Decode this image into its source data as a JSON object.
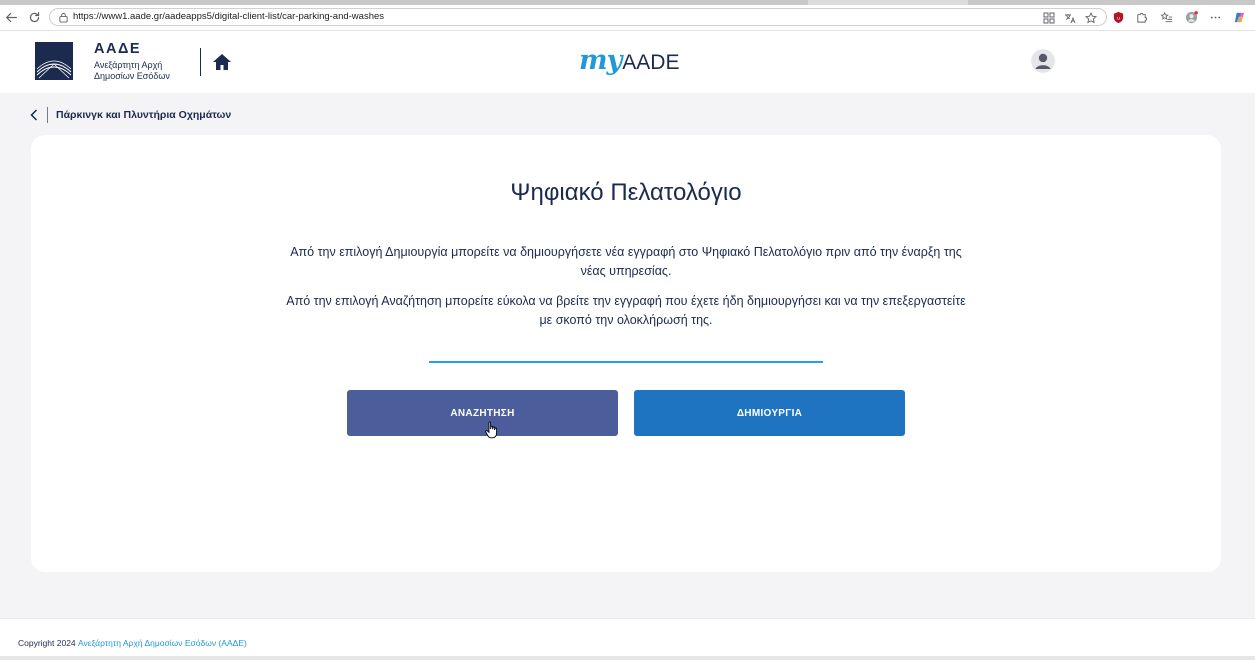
{
  "browser": {
    "url": "https://www1.aade.gr/aadeapps5/digital-client-list/car-parking-and-washes"
  },
  "header": {
    "logo_title": "ΑΑΔΕ",
    "logo_subtitle_line1": "Ανεξάρτητη Αρχή",
    "logo_subtitle_line2": "Δημοσίων Εσόδων",
    "brand_my": "my",
    "brand_aade": "AADE"
  },
  "breadcrumb": {
    "title": "Πάρκινγκ και Πλυντήρια Οχημάτων"
  },
  "main": {
    "title": "Ψηφιακό Πελατολόγιο",
    "description_1": "Από την επιλογή Δημιουργία μπορείτε να δημιουργήσετε νέα εγγραφή στο Ψηφιακό Πελατολόγιο πριν από την έναρξη της νέας υπηρεσίας.",
    "description_2": "Από την επιλογή Αναζήτηση μπορείτε εύκολα να βρείτε την εγγραφή που έχετε ήδη δημιουργήσει και να την επεξεργαστείτε με σκοπό την ολοκλήρωσή της.",
    "search_button": "ΑΝΑΖΗΤΗΣΗ",
    "create_button": "ΔΗΜΙΟΥΡΓΙΑ"
  },
  "footer": {
    "copyright_prefix": "Copyright 2024",
    "copyright_link": "Ανεξάρτητη Αρχή Δημοσίων Εσόδων (ΑΑΔΕ)"
  },
  "colors": {
    "primary_navy": "#1b2a4e",
    "accent_blue": "#1f9ad6",
    "search_button_bg": "#4b5d9a",
    "create_button_bg": "#1f74c2",
    "page_bg": "#f4f4f6"
  },
  "icons": {
    "back": "arrow-left-icon",
    "reload": "reload-icon",
    "home": "home-icon",
    "profile": "user-avatar-icon",
    "breadcrumb_back": "chevron-left-icon"
  }
}
